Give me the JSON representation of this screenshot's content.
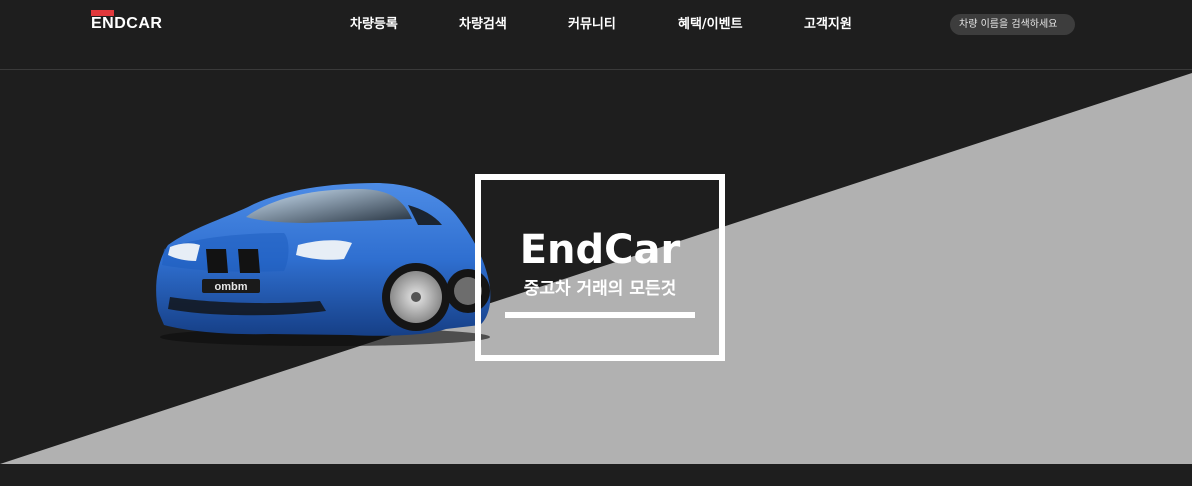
{
  "brand": {
    "logo_text": "ENDCAR",
    "accent_color": "#e0383b"
  },
  "nav": {
    "items": [
      {
        "label": "차량등록"
      },
      {
        "label": "차량검색"
      },
      {
        "label": "커뮤니티"
      },
      {
        "label": "혜택/이벤트"
      },
      {
        "label": "고객지원"
      }
    ]
  },
  "search": {
    "placeholder": "차량 이름을 검색하세요"
  },
  "hero": {
    "title": "EndCar",
    "subtitle": "중고차 거래의 모든것",
    "license_plate": "ombm",
    "colors": {
      "dark": "#1e1e1e",
      "light": "#b1b1b1",
      "car_body": "#2f6fd0"
    }
  }
}
